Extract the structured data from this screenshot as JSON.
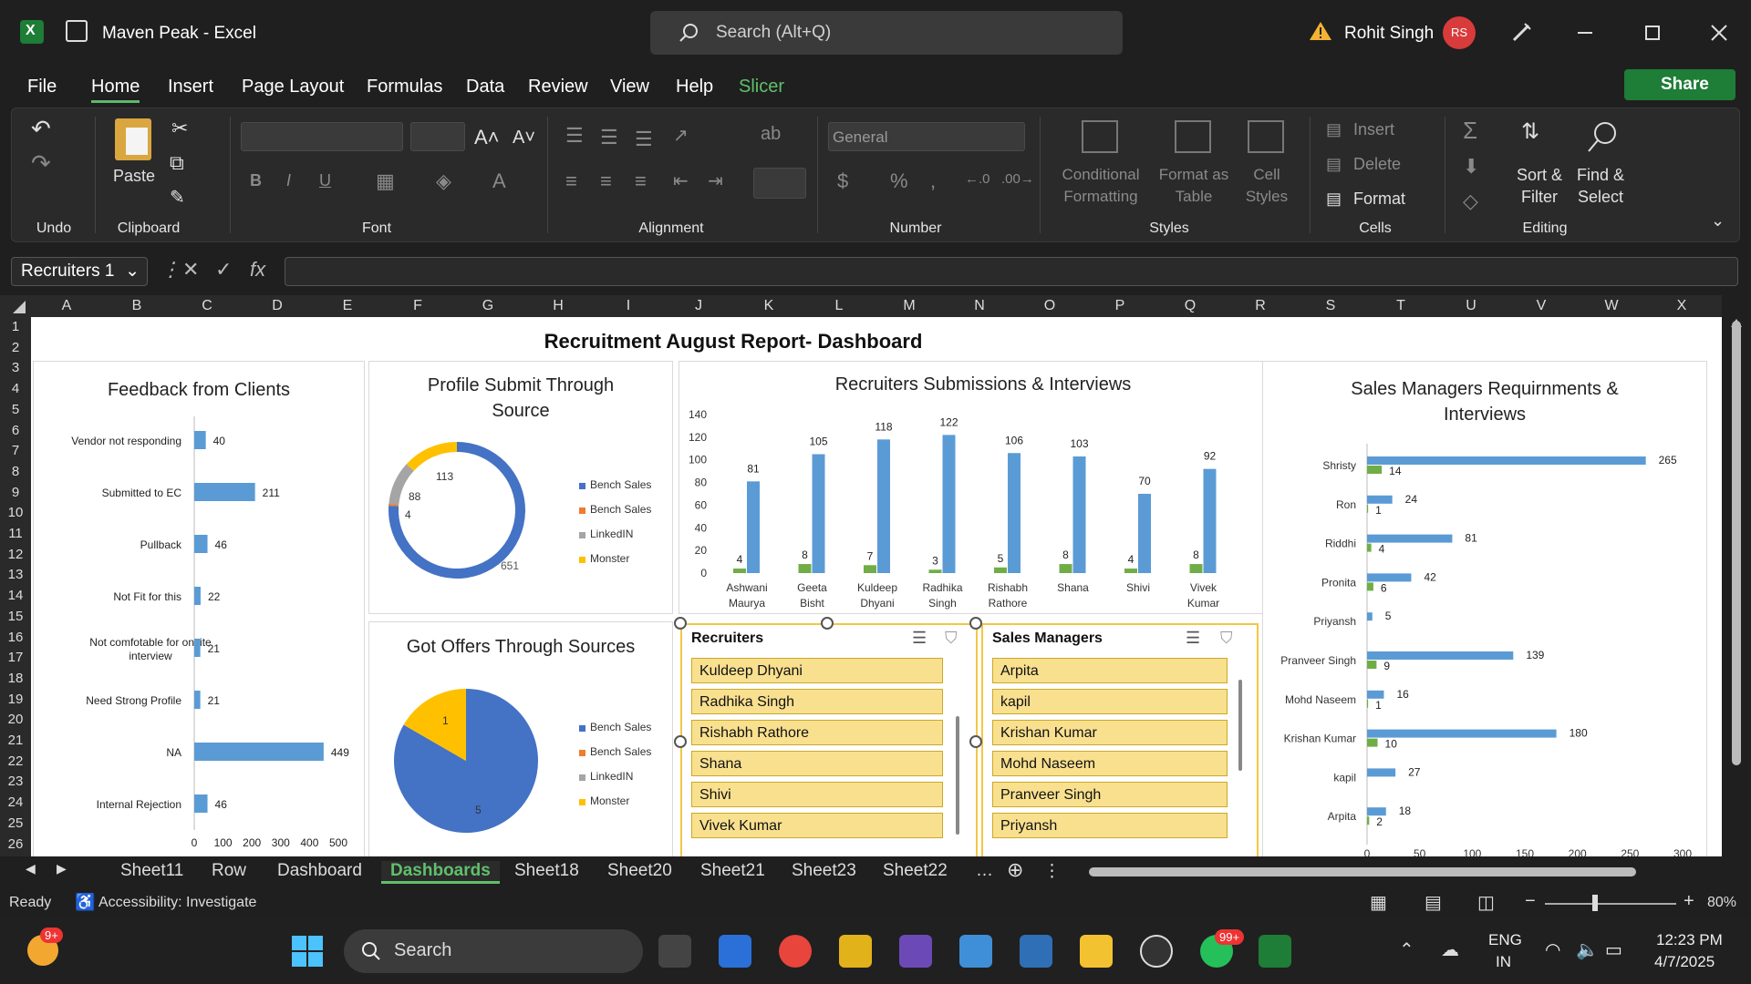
{
  "window": {
    "title": "Maven Peak  -  Excel",
    "search_placeholder": "Search (Alt+Q)",
    "user_name": "Rohit Singh",
    "user_initials": "RS"
  },
  "menu": {
    "items": [
      "File",
      "Home",
      "Insert",
      "Page Layout",
      "Formulas",
      "Data",
      "Review",
      "View",
      "Help",
      "Slicer"
    ],
    "share_label": "Share"
  },
  "ribbon": {
    "undo_label": "Undo",
    "paste_label": "Paste",
    "clipboard_label": "Clipboard",
    "font_label": "Font",
    "alignment_label": "Alignment",
    "number_format": "General",
    "number_label": "Number",
    "conditional_formatting": "Conditional Formatting",
    "format_as_table": "Format as Table",
    "cell_styles": "Cell Styles",
    "styles_label": "Styles",
    "insert_label": "Insert",
    "delete_label": "Delete",
    "format_label": "Format",
    "cells_label": "Cells",
    "sort_filter": "Sort & Filter",
    "find_select": "Find & Select",
    "editing_label": "Editing"
  },
  "formula_bar": {
    "name_box": "Recruiters 1",
    "content": ""
  },
  "columns": [
    "A",
    "B",
    "C",
    "D",
    "E",
    "F",
    "G",
    "H",
    "I",
    "J",
    "K",
    "L",
    "M",
    "N",
    "O",
    "P",
    "Q",
    "R",
    "S",
    "T",
    "U",
    "V",
    "W",
    "X"
  ],
  "rows": [
    "1",
    "2",
    "3",
    "4",
    "5",
    "6",
    "7",
    "8",
    "9",
    "10",
    "11",
    "12",
    "13",
    "14",
    "15",
    "16",
    "17",
    "18",
    "19",
    "20",
    "21",
    "22",
    "23",
    "24",
    "25",
    "26"
  ],
  "dashboard": {
    "title": "Recruitment August Report- Dashboard",
    "feedback": {
      "title": "Feedback from Clients",
      "categories": [
        "Vendor not responding",
        "Submitted to EC",
        "Pullback",
        "Not Fit for this",
        "Not comfotable for onsite interview",
        "Need Strong Profile",
        "NA",
        "Internal Rejection"
      ],
      "values": [
        40,
        211,
        46,
        22,
        21,
        21,
        449,
        46
      ],
      "ticks": [
        "0",
        "100",
        "200",
        "300",
        "400",
        "500"
      ]
    },
    "profile_submit": {
      "title": "Profile Submit Through Source",
      "legend": [
        "Bench Sales",
        "Bench Sales",
        "LinkedIN",
        "Monster"
      ],
      "values": [
        651,
        4,
        88,
        113
      ]
    },
    "got_offers": {
      "title": "Got Offers Through Sources",
      "legend": [
        "Bench Sales",
        "Bench Sales",
        "LinkedIN",
        "Monster"
      ],
      "values": [
        5,
        0,
        0,
        1
      ]
    },
    "recruiters_chart": {
      "title": "Recruiters Submissions & Interviews",
      "categories": [
        "Ashwani Maurya",
        "Geeta Bisht",
        "Kuldeep Dhyani",
        "Radhika Singh",
        "Rishabh Rathore",
        "Shana",
        "Shivi",
        "Vivek Kumar"
      ],
      "interviews": [
        4,
        8,
        7,
        3,
        5,
        8,
        4,
        8
      ],
      "submissions": [
        81,
        105,
        118,
        122,
        106,
        103,
        70,
        92
      ],
      "ticks": [
        "0",
        "20",
        "40",
        "60",
        "80",
        "100",
        "120",
        "140"
      ]
    },
    "sales_chart": {
      "title": "Sales Managers Requirnments & Interviews",
      "categories": [
        "Shristy",
        "Ron",
        "Riddhi",
        "Pronita",
        "Priyansh",
        "Pranveer Singh",
        "Mohd Naseem",
        "Krishan Kumar",
        "kapil",
        "Arpita"
      ],
      "requirements": [
        265,
        24,
        81,
        42,
        5,
        139,
        16,
        180,
        27,
        18
      ],
      "interviews": [
        14,
        1,
        4,
        6,
        0,
        9,
        1,
        10,
        0,
        2
      ],
      "ticks": [
        "0",
        "50",
        "100",
        "150",
        "200",
        "250",
        "300"
      ]
    },
    "slicer_recruiters": {
      "title": "Recruiters",
      "items": [
        "Kuldeep Dhyani",
        "Radhika Singh",
        "Rishabh Rathore",
        "Shana",
        "Shivi",
        "Vivek Kumar"
      ]
    },
    "slicer_sales": {
      "title": "Sales Managers",
      "items": [
        "Arpita",
        "kapil",
        "Krishan Kumar",
        "Mohd Naseem",
        "Pranveer Singh",
        "Priyansh"
      ]
    }
  },
  "colors": {
    "blue": "#4472c4",
    "bar_blue": "#5b9bd5",
    "green": "#70ad47",
    "orange": "#ed7d31",
    "gray": "#a5a5a5",
    "yellow": "#ffc000"
  },
  "sheet_tabs": [
    "Sheet11",
    "Row",
    "Dashboard",
    "Dashboards",
    "Sheet18",
    "Sheet20",
    "Sheet21",
    "Sheet23",
    "Sheet22"
  ],
  "status": {
    "ready": "Ready",
    "accessibility": "Accessibility: Investigate",
    "zoom": "80%"
  },
  "taskbar": {
    "search_label": "Search",
    "whatsapp_badge": "99+",
    "widget_badge": "9+",
    "lang": "ENG",
    "region": "IN",
    "time": "12:23 PM",
    "date": "4/7/2025"
  }
}
